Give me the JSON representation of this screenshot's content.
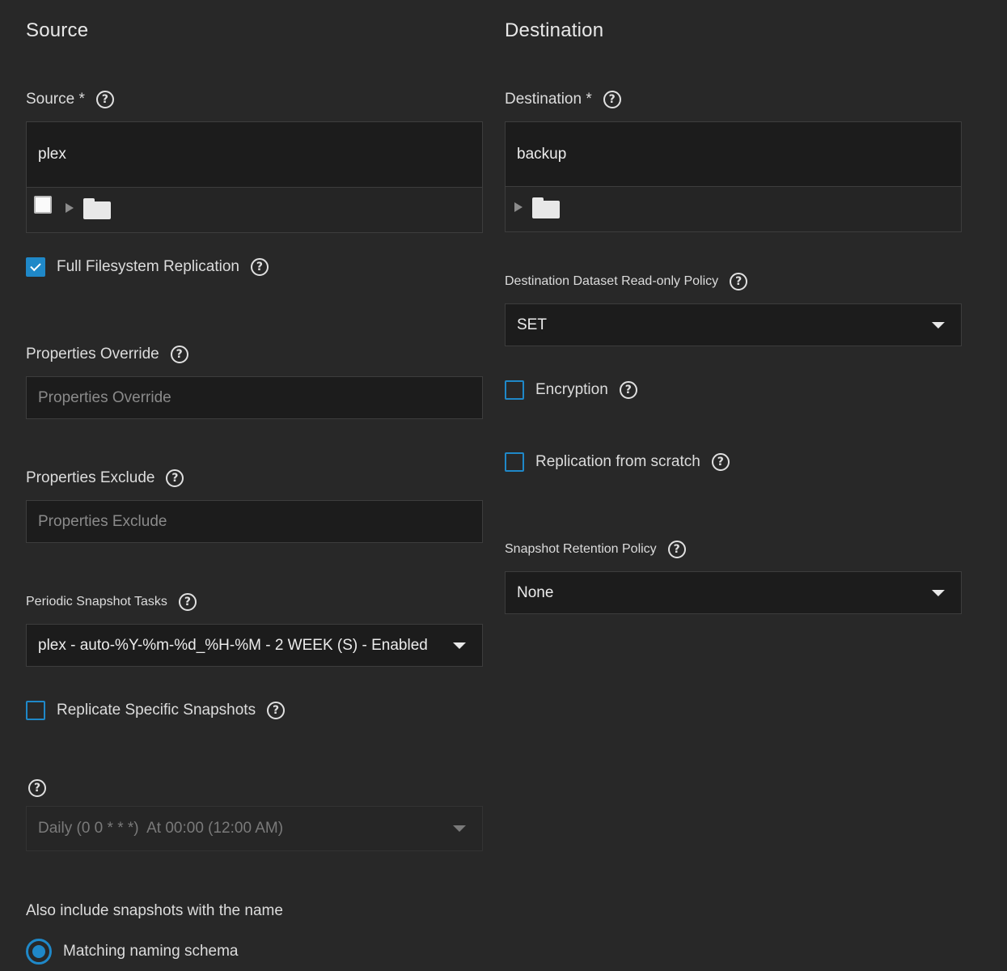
{
  "source": {
    "section_title": "Source",
    "source_label": "Source *",
    "source_value": "plex",
    "full_fs_label": "Full Filesystem Replication",
    "full_fs_checked": true,
    "properties_override_label": "Properties Override",
    "properties_override_placeholder": "Properties Override",
    "properties_exclude_label": "Properties Exclude",
    "properties_exclude_placeholder": "Properties Exclude",
    "periodic_tasks_label": "Periodic Snapshot Tasks",
    "periodic_tasks_value": "plex - auto-%Y-%m-%d_%H-%M - 2 WEEK (S) - Enabled",
    "replicate_specific_label": "Replicate Specific Snapshots",
    "replicate_specific_checked": false,
    "schedule_value": "Daily (0 0 * * *)  At 00:00 (12:00 AM)",
    "also_include_label": "Also include snapshots with the name",
    "matching_schema_label": "Matching naming schema"
  },
  "destination": {
    "section_title": "Destination",
    "destination_label": "Destination *",
    "destination_value": "backup",
    "readonly_policy_label": "Destination Dataset Read-only Policy",
    "readonly_policy_value": "SET",
    "encryption_label": "Encryption",
    "encryption_checked": false,
    "replication_scratch_label": "Replication from scratch",
    "replication_scratch_checked": false,
    "retention_policy_label": "Snapshot Retention Policy",
    "retention_policy_value": "None"
  },
  "icons": {
    "help": "help-circle-icon",
    "folder": "folder-icon",
    "expand": "expand-triangle-icon",
    "dropdown": "dropdown-arrow-icon"
  },
  "colors": {
    "background": "#282828",
    "field_background": "#1c1c1c",
    "accent": "#1f88c8"
  }
}
